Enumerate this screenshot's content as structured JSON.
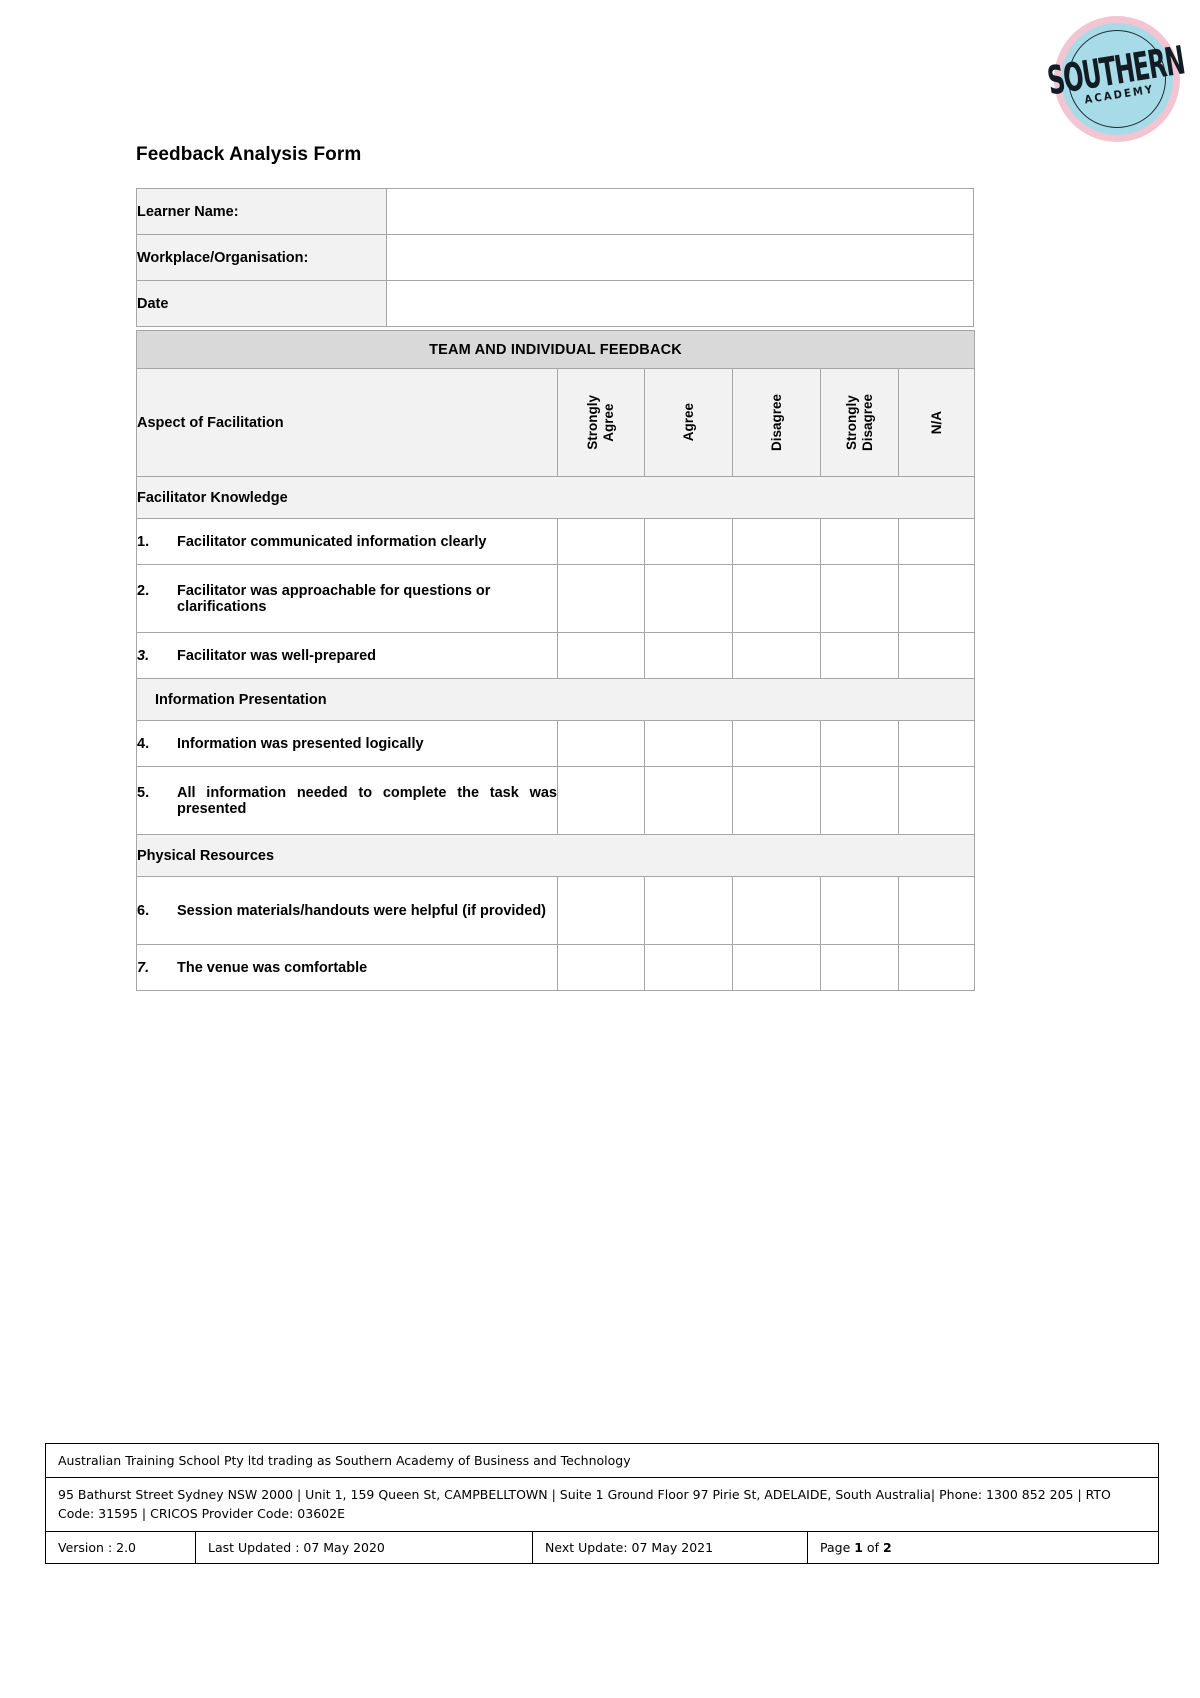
{
  "logo": {
    "name": "southern-academy-logo",
    "main_text": "SOUTHERN",
    "sub_text": "ACADEMY",
    "ring_color": "#f3c4d2",
    "disc_color": "#a8dbe8",
    "text_color": "#111c24"
  },
  "page_title": "Feedback Analysis Form",
  "form_fields": [
    {
      "label": "Learner Name:",
      "value": ""
    },
    {
      "label": "Workplace/Organisation:",
      "value": ""
    },
    {
      "label": "Date",
      "value": ""
    }
  ],
  "feedback": {
    "banner": "TEAM AND INDIVIDUAL FEEDBACK",
    "aspect_header": "Aspect of Facilitation",
    "rating_columns": [
      "Strongly\nAgree",
      "Agree",
      "Disagree",
      "Strongly\nDisagree",
      "N/A"
    ],
    "sections": [
      {
        "title": "Facilitator Knowledge",
        "items": [
          {
            "num": "1.",
            "text": "Facilitator communicated information clearly"
          },
          {
            "num": "2.",
            "text": "Facilitator was approachable for questions or clarifications"
          },
          {
            "num": "3.",
            "text": "Facilitator was well-prepared"
          }
        ]
      },
      {
        "title": "Information Presentation",
        "items": [
          {
            "num": "4.",
            "text": "Information was presented logically"
          },
          {
            "num": "5.",
            "text": "All information needed to complete the task was presented"
          }
        ]
      },
      {
        "title": "Physical Resources",
        "items": [
          {
            "num": "6.",
            "text": "Session materials/handouts were helpful (if provided)"
          },
          {
            "num": "7.",
            "text": "The venue was comfortable"
          }
        ]
      }
    ]
  },
  "footer": {
    "legal": "Australian Training School Pty ltd trading as Southern Academy of Business and Technology",
    "address": "95 Bathurst Street Sydney NSW 2000 | Unit 1, 159 Queen St, CAMPBELLTOWN | Suite 1 Ground Floor 97 Pirie St, ADELAIDE, South Australia| Phone: 1300 852 205 |  RTO Code: 31595  | CRICOS Provider Code: 03602E",
    "version": "Version : 2.0",
    "last_updated": "Last Updated : 07 May 2020",
    "next_update": "Next Update: 07 May 2021",
    "page_prefix": "Page ",
    "page_current": "1",
    "page_middle": " of ",
    "page_total": "2"
  }
}
